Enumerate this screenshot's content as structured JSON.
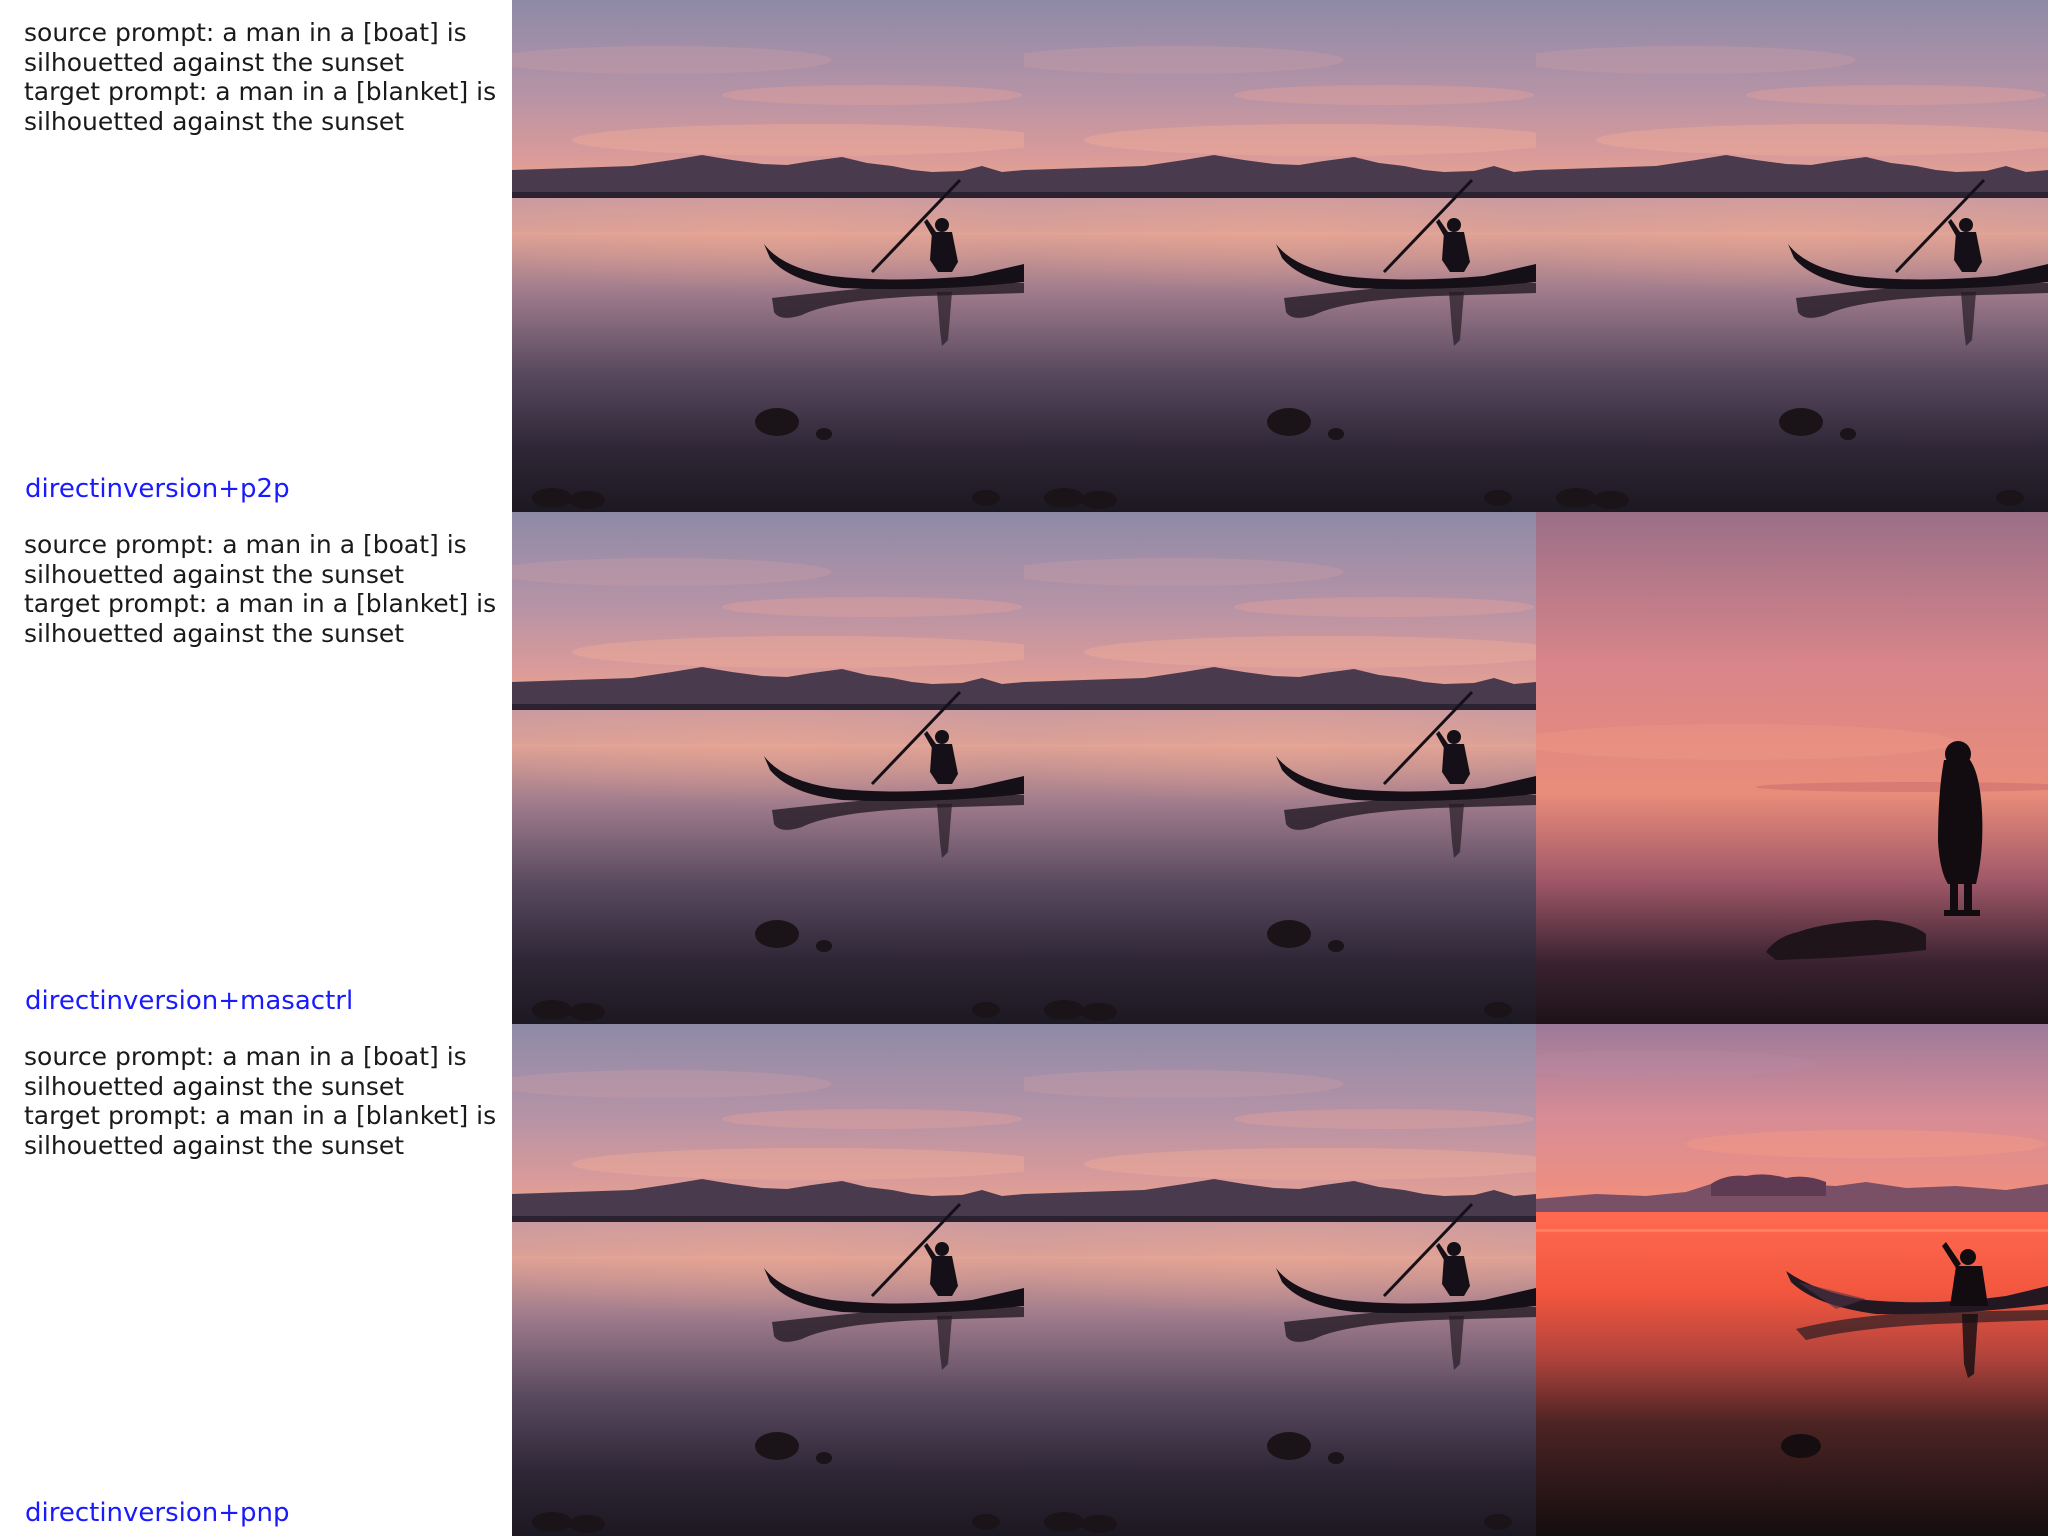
{
  "rows": [
    {
      "prompt": "source prompt: a man in a [boat] is\nsilhouetted against the sunset\ntarget prompt: a man in a [blanket] is\nsilhouetted against the sunset",
      "method": "directinversion+p2p",
      "images": [
        "source-boat-sunset",
        "reconstructed-boat-sunset",
        "edited-boat-sunset"
      ]
    },
    {
      "prompt": "source prompt: a man in a [boat] is\nsilhouetted against the sunset\ntarget prompt: a man in a [blanket] is\nsilhouetted against the sunset",
      "method": "directinversion+masactrl",
      "images": [
        "source-boat-sunset",
        "reconstructed-boat-sunset",
        "edited-man-in-blanket"
      ]
    },
    {
      "prompt": "source prompt: a man in a [boat] is\nsilhouetted against the sunset\ntarget prompt: a man in a [blanket] is\nsilhouetted against the sunset",
      "method": "directinversion+pnp",
      "images": [
        "source-boat-sunset",
        "reconstructed-boat-sunset",
        "edited-red-sunset-boat"
      ]
    }
  ],
  "colors": {
    "prompt_text": "#1a1a1a",
    "method_label": "#1a1aff",
    "background": "#ffffff"
  }
}
